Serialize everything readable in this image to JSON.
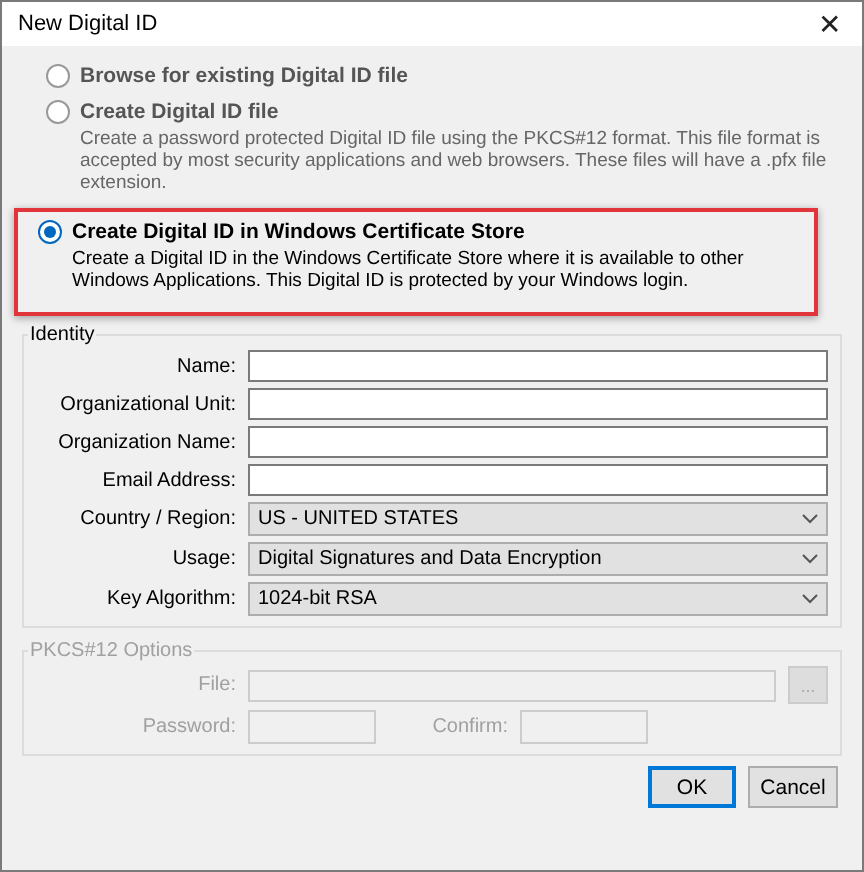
{
  "window": {
    "title": "New Digital ID",
    "close": "✕"
  },
  "options": [
    {
      "label": "Browse for existing Digital ID file",
      "selected": false,
      "highlighted": false
    },
    {
      "label": "Create Digital ID file",
      "selected": false,
      "highlighted": false,
      "description": "Create a password protected Digital ID file using the PKCS#12 format. This file format is accepted by most security applications and web browsers. These files will have a .pfx file extension."
    },
    {
      "label": "Create Digital ID in Windows Certificate Store",
      "selected": true,
      "highlighted": true,
      "description": "Create a Digital ID in the Windows Certificate Store where it is available to other Windows Applications. This Digital ID is protected by your Windows login."
    }
  ],
  "identity": {
    "title": "Identity",
    "fields": [
      {
        "label": "Name:",
        "kind": "text"
      },
      {
        "label": "Organizational Unit:",
        "kind": "text"
      },
      {
        "label": "Organization Name:",
        "kind": "text"
      },
      {
        "label": "Email Address:",
        "kind": "text"
      },
      {
        "label": "Country / Region:",
        "kind": "select",
        "value": "US - UNITED STATES"
      },
      {
        "label": "Usage:",
        "kind": "select",
        "value": "Digital Signatures and Data Encryption"
      },
      {
        "label": "Key Algorithm:",
        "kind": "select",
        "value": "1024-bit RSA"
      }
    ]
  },
  "pkcs": {
    "title": "PKCS#12 Options",
    "disabled": true,
    "file_label": "File:",
    "browse": "...",
    "password_label": "Password:",
    "confirm_label": "Confirm:"
  },
  "buttons": [
    {
      "label": "OK",
      "default": true
    },
    {
      "label": "Cancel",
      "default": false
    }
  ]
}
